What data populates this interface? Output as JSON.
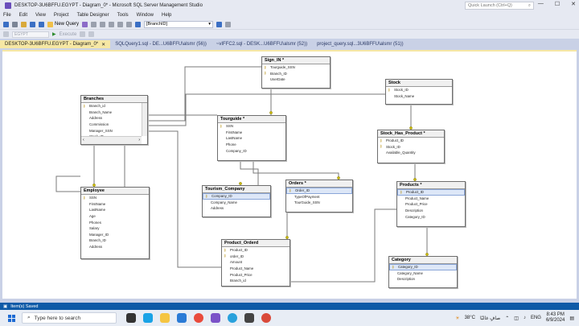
{
  "window": {
    "title": "DESKTOP-3U6BFFU.EGYPT - Diagram_0* - Microsoft SQL Server Management Studio",
    "quick_launch": "Quick Launch (Ctrl+Q)"
  },
  "menu": [
    "File",
    "Edit",
    "View",
    "Project",
    "Table Designer",
    "Tools",
    "Window",
    "Help"
  ],
  "toolbar": {
    "new_query": "New Query",
    "combo_value": "[BranchID]",
    "db_combo": "EGYPT",
    "execute": "Execute"
  },
  "tabs": [
    {
      "label": "DESKTOP-3U6BFFU.EGYPT - Diagram_0*",
      "active": true
    },
    {
      "label": "SQLQuery1.sql - DE...U6BFFU\\alsmr (56))",
      "active": false
    },
    {
      "label": "~vIFFC2.sql - DESK...U6BFFU\\alsmr (52))",
      "active": false
    },
    {
      "label": "project_query.sql...3U6BFFU\\alsmr (51))",
      "active": false
    }
  ],
  "tables": {
    "sign_in": {
      "name": "Sign_IN *",
      "cols": [
        "Tourguide_SSN",
        "Branch_ID",
        "UserDate"
      ],
      "keys": [
        true,
        true,
        false
      ]
    },
    "stock": {
      "name": "Stock",
      "cols": [
        "Stock_ID",
        "Stock_Name"
      ],
      "keys": [
        true,
        false
      ]
    },
    "branches": {
      "name": "Branches",
      "cols": [
        "Branch_id",
        "Branch_Name",
        "Address",
        "Commission",
        "Manager_SSN",
        "Stock_ID"
      ],
      "keys": [
        true,
        false,
        false,
        false,
        false,
        false
      ]
    },
    "tourguide": {
      "name": "Tourguide *",
      "cols": [
        "SSN",
        "FirstName",
        "LastName",
        "Phone",
        "Company_ID"
      ],
      "keys": [
        true,
        false,
        false,
        false,
        false
      ]
    },
    "stock_has_product": {
      "name": "Stock_Has_Product *",
      "cols": [
        "Product_ID",
        "Stock_ID",
        "Available_Quantity"
      ],
      "keys": [
        true,
        true,
        false
      ]
    },
    "employee": {
      "name": "Employee",
      "cols": [
        "SSN",
        "FirstName",
        "LastName",
        "Age",
        "Phones",
        "Salary",
        "Manager_ID",
        "Branch_ID",
        "Address"
      ],
      "keys": [
        true,
        false,
        false,
        false,
        false,
        false,
        false,
        false,
        false
      ]
    },
    "tourism_company": {
      "name": "Tourism_Company",
      "cols": [
        "Company_ID",
        "Company_Name",
        "Address"
      ],
      "keys": [
        true,
        false,
        false
      ]
    },
    "orders": {
      "name": "Orders *",
      "cols": [
        "Order_ID",
        "TypeOfPayment",
        "TourGuide_SSN"
      ],
      "keys": [
        true,
        false,
        false
      ]
    },
    "products": {
      "name": "Products *",
      "cols": [
        "Product_ID",
        "Product_Name",
        "Product_Price",
        "Description",
        "Category_ID"
      ],
      "keys": [
        true,
        false,
        false,
        false,
        false
      ]
    },
    "product_orderd": {
      "name": "Product_Orderd",
      "cols": [
        "Product_ID",
        "order_ID",
        "Amount",
        "Product_Name",
        "Product_Price",
        "Branch_id"
      ],
      "keys": [
        true,
        true,
        false,
        false,
        false,
        false
      ]
    },
    "category": {
      "name": "Category",
      "cols": [
        "Category_ID",
        "Category_Name",
        "Description"
      ],
      "keys": [
        true,
        false,
        false
      ]
    }
  },
  "status": {
    "text": "Item(s) Saved"
  },
  "taskbar": {
    "search_placeholder": "Type here to search",
    "weather": "38°C",
    "weather_desc": "صافٍ غالبًا",
    "lang": "ENG",
    "time": "8:43 PM",
    "date": "6/9/2024"
  },
  "colors": {
    "accent": "#0e5aa7",
    "active_tab": "#f6e7a4",
    "relationship_line": "#7a7a7a"
  }
}
